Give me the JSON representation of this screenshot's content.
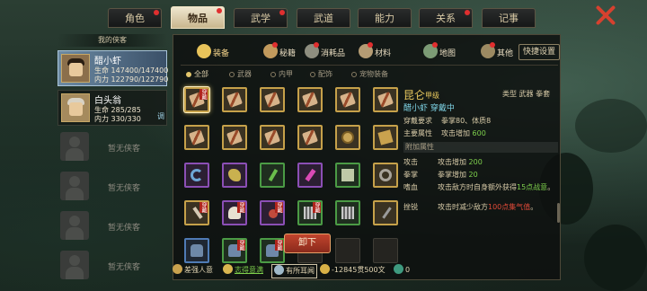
{
  "tabs": [
    {
      "label": "角色",
      "dot": true
    },
    {
      "label": "物品",
      "dot": true,
      "active": true
    },
    {
      "label": "武学",
      "dot": true
    },
    {
      "label": "武道",
      "dot": false
    },
    {
      "label": "能力",
      "dot": false
    },
    {
      "label": "关系",
      "dot": true
    },
    {
      "label": "记事",
      "dot": false
    }
  ],
  "left": {
    "header": "我的侠客",
    "characters": [
      {
        "name": "醋小虾",
        "hp_label": "生命",
        "hp": "147400/147400",
        "mp_label": "内力",
        "mp": "122790/122790",
        "selected": true
      },
      {
        "name": "白头翁",
        "hp_label": "生命",
        "hp": "285/285",
        "mp_label": "内力",
        "mp": "330/330",
        "tag": "调"
      }
    ],
    "empty_label": "暂无侠客"
  },
  "categories": [
    {
      "label": "装备",
      "color": "#e8c35a",
      "active": true
    },
    {
      "label": "秘籍",
      "color": "#c29a5d",
      "dot": true
    },
    {
      "label": "消耗品",
      "color": "#8e8e7f",
      "dot": true
    },
    {
      "label": "材料",
      "color": "#b59c74",
      "dot": true
    },
    {
      "label": "地图",
      "color": "#7c9b75",
      "dot": true
    },
    {
      "label": "其他",
      "color": "#9c8a62",
      "dot": true
    }
  ],
  "quick_settings": "快捷设置",
  "filters": [
    {
      "label": "全部",
      "on": true
    },
    {
      "label": "武器"
    },
    {
      "label": "内甲"
    },
    {
      "label": "配饰"
    },
    {
      "label": "宠物装备"
    }
  ],
  "equipped_badge": "穿戴",
  "items": [
    [
      "scroll|gold|badge|sel",
      "scroll|gold",
      "scroll|gold",
      "scroll|gold",
      "scroll|gold",
      "scroll|gold"
    ],
    [
      "scroll|gold",
      "scroll|gold",
      "scroll|gold",
      "scroll|gold",
      "face|gold",
      "paper|gold"
    ],
    [
      "hook|purple",
      "gold|purple",
      "stick|green",
      "pink|purple",
      "sheet|green",
      "ring|gold"
    ],
    [
      "brush|gold|badge",
      "white|purple|badge",
      "red|purple|badge",
      "claw|green|badge",
      "claw|green",
      "staff|gold"
    ],
    [
      "armor|blue",
      "armor|green|badge",
      "armor|green|badge",
      "|blank",
      "|blank",
      "|blank"
    ]
  ],
  "detail": {
    "name": "昆仑",
    "grade": "甲级",
    "type": "类型  武器 拳套",
    "owner": "醋小虾 穿戴中",
    "req_label": "穿戴要求",
    "req_value": "拳掌80、体质8",
    "main_label": "主要属性",
    "main_prefix": "攻击增加 ",
    "main_value": "600",
    "extra_header": "附加属性",
    "attrs": [
      {
        "k": "攻击",
        "v1": "攻击增加 ",
        "v2": "200",
        "v3": ""
      },
      {
        "k": "拳掌",
        "v1": "拳掌增加 ",
        "v2": "20",
        "v3": ""
      },
      {
        "k": "嗜血",
        "v1": "攻击敌方时自身额外获得",
        "v2": "15点战意",
        "v3": "。"
      },
      {
        "k": "挫锐",
        "v1": "攻击时减少敌方",
        "v2": "100点集气值",
        "v3": "。"
      }
    ],
    "unequip": "卸下"
  },
  "status": [
    {
      "label": "差强人意",
      "color": "#c9a24e"
    },
    {
      "label": "志得意满",
      "color": "#d9b650",
      "green": true
    },
    {
      "label": "有所耳闻",
      "color": "#9fb9c9",
      "boxed": true
    },
    {
      "label": "-12845贯500文",
      "color": "#d8b046"
    },
    {
      "label": "0",
      "color": "#3e9a7f"
    }
  ]
}
